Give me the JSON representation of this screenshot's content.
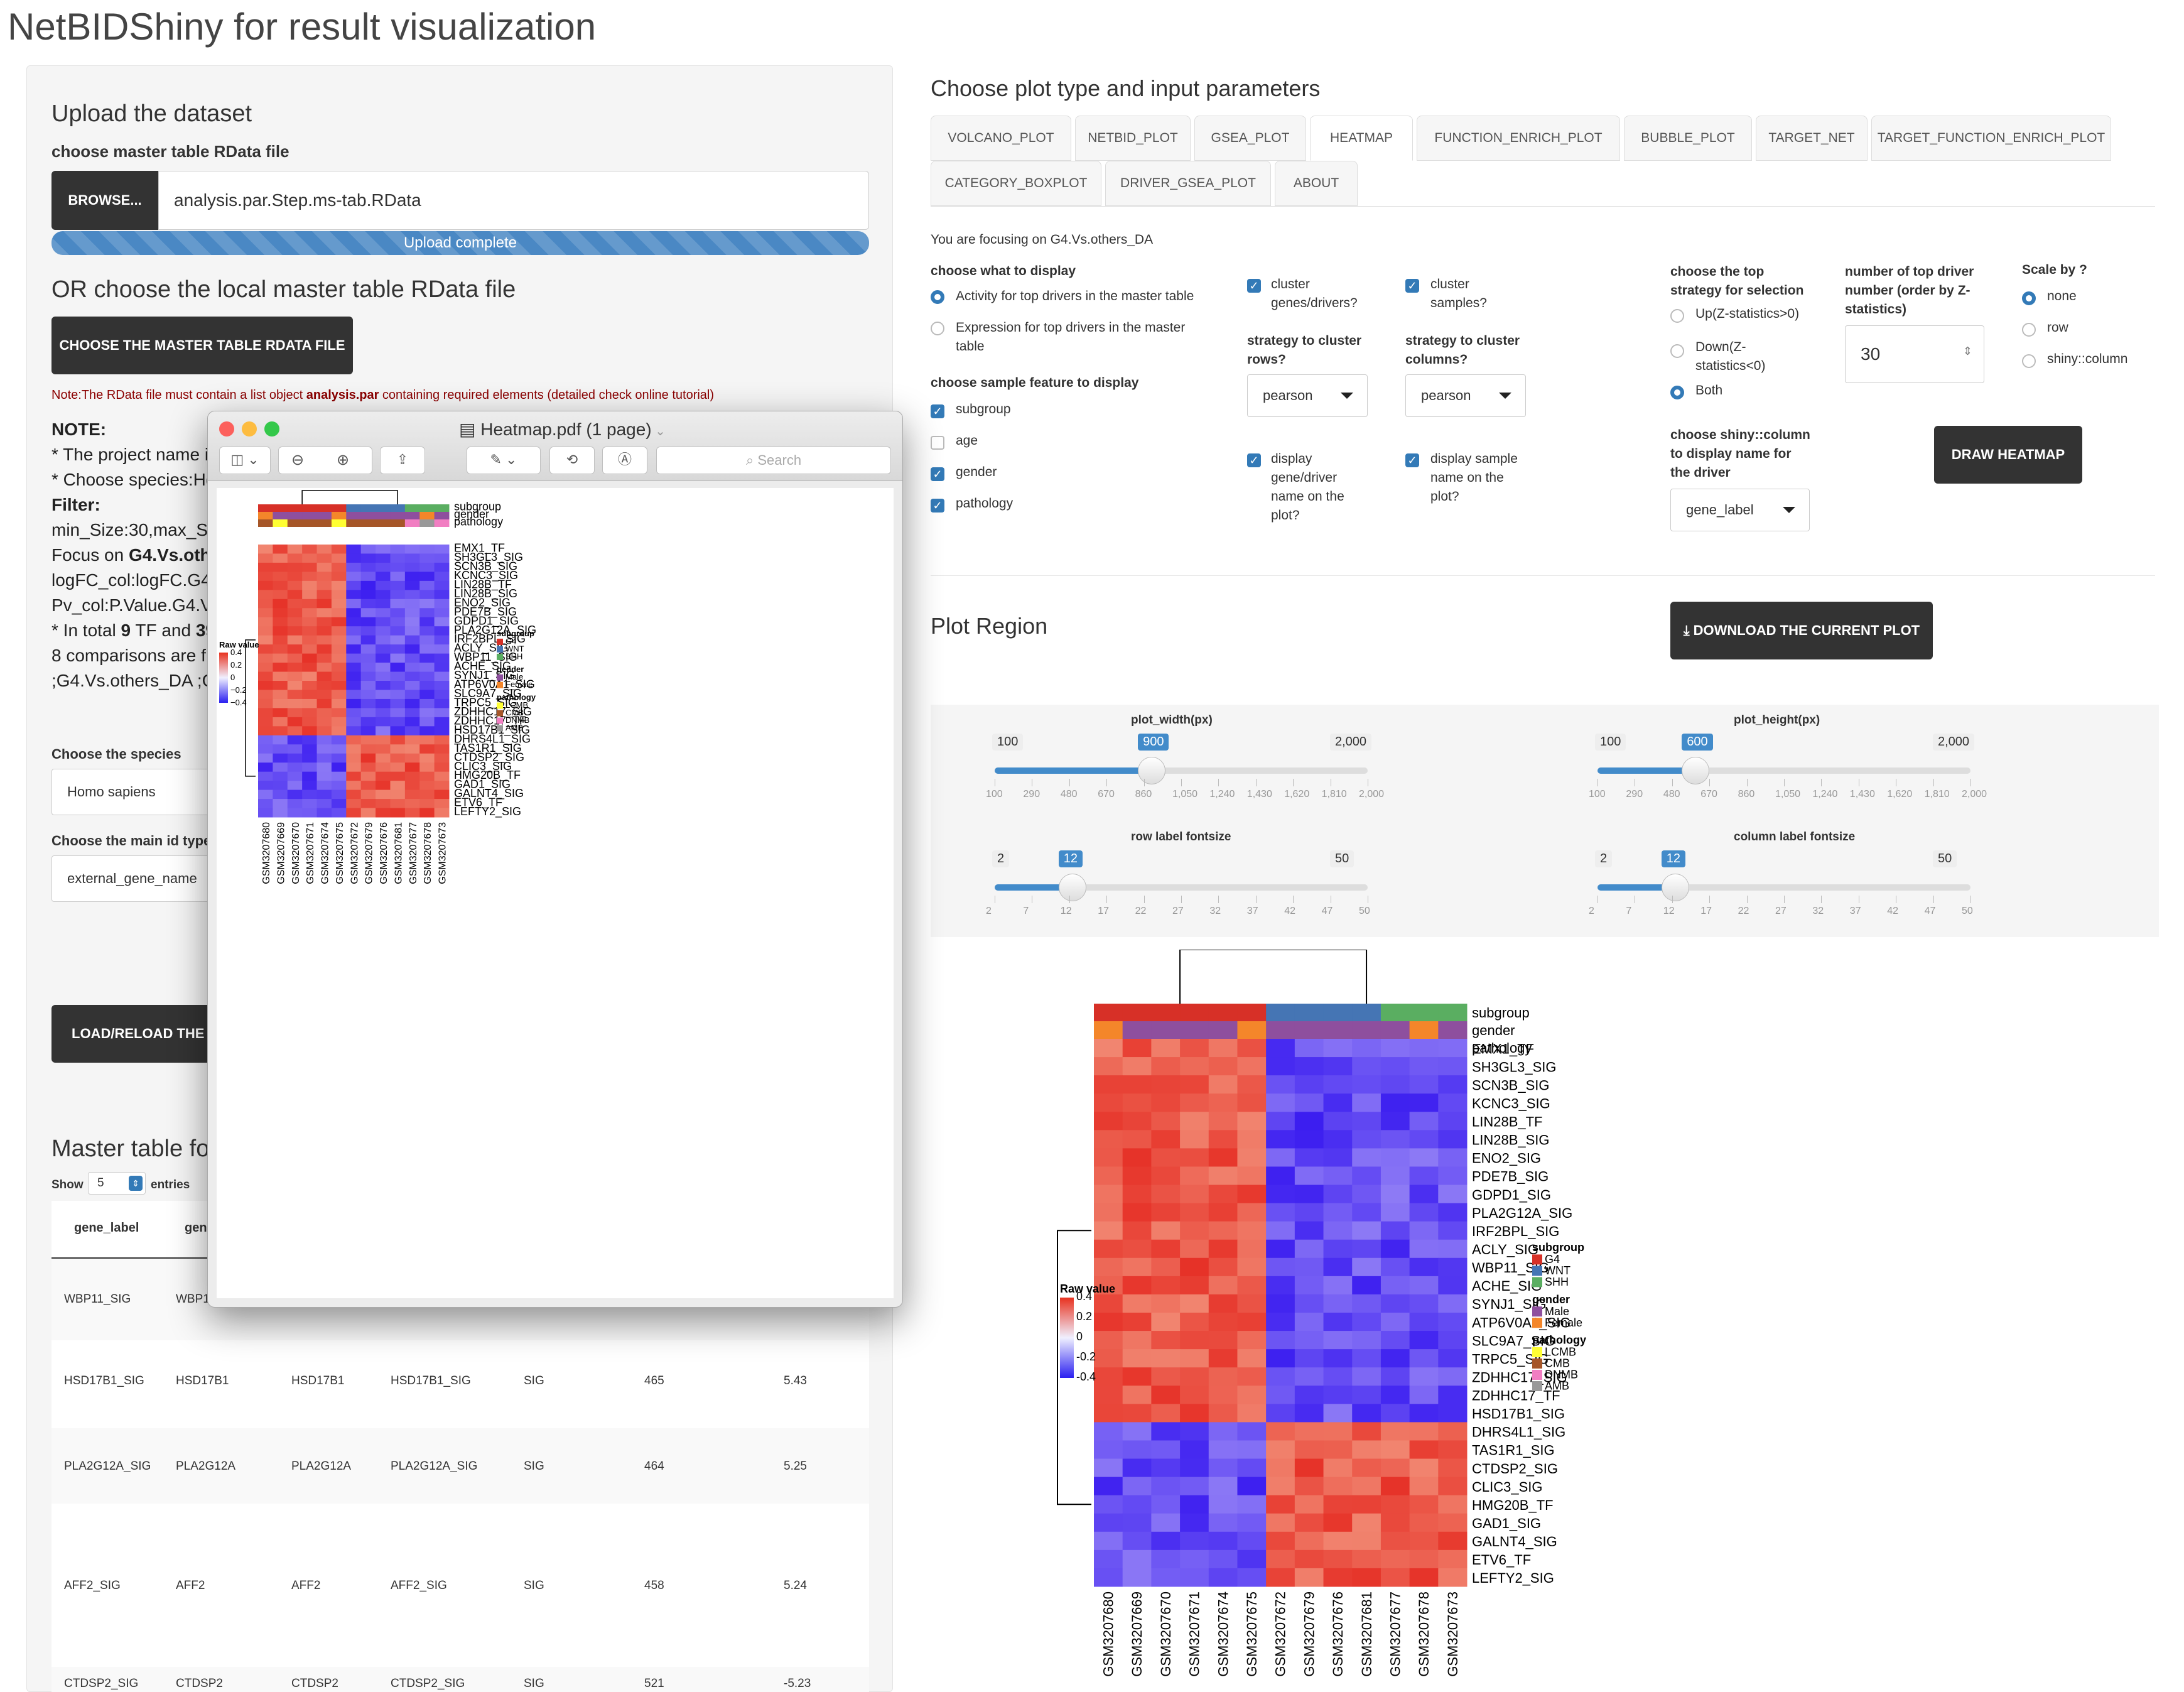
{
  "app_title": "NetBIDShiny for result visualization",
  "upload": {
    "heading": "Upload the dataset",
    "master_label": "choose master table RData file",
    "browse_label": "BROWSE...",
    "file_value": "analysis.par.Step.ms-tab.RData",
    "progress_text": "Upload complete",
    "progress_fraction": 1.0,
    "or_heading": "OR choose the local master table RData file",
    "choose_button": "CHOOSE THE MASTER TABLE RDATA FILE",
    "note_prefix": "Note:The RData file must contain a list object ",
    "note_bold": "analysis.par",
    "note_suffix": " containing required elements (detailed check online tutorial)"
  },
  "notes": {
    "l1": "NOTE:",
    "l2": "* The project name i",
    "l3": "* Choose species:Ho",
    "l4": "Filter:",
    "l5": "min_Size:30,max_Si",
    "l6a": "Focus on ",
    "l6b": "G4.Vs.othe",
    "l7": "logFC_col:logFC.G4.",
    "l8": "Pv_col:P.Value.G4.V",
    "l9a": "* In total ",
    "l9b": "9",
    "l9c": " TF and ",
    "l9d": "39",
    "l10": "8 comparisons are f",
    "l11": ";G4.Vs.others_DA ;G"
  },
  "species": {
    "label": "Choose the species",
    "value": "Homo sapiens"
  },
  "idtype": {
    "label": "Choose the main id type",
    "value": "external_gene_name"
  },
  "load_button": "LOAD/RELOAD THE UI",
  "master_table": {
    "heading": "Master table for",
    "show_label": "Show",
    "show_value": "5",
    "entries_label": "entries",
    "col1": "gene_label",
    "col2": "gene",
    "rows": [
      [
        "WBP11_SIG",
        "WBP1",
        "",
        "",
        "",
        "",
        ""
      ],
      [
        "HSD17B1_SIG",
        "HSD17B1",
        "HSD17B1",
        "HSD17B1_SIG",
        "SIG",
        "465",
        "5.43"
      ],
      [
        "PLA2G12A_SIG",
        "PLA2G12A",
        "PLA2G12A",
        "PLA2G12A_SIG",
        "SIG",
        "464",
        "5.25"
      ],
      [
        "AFF2_SIG",
        "AFF2",
        "AFF2",
        "AFF2_SIG",
        "SIG",
        "458",
        "5.24"
      ],
      [
        "CTDSP2_SIG",
        "CTDSP2",
        "CTDSP2",
        "CTDSP2_SIG",
        "SIG",
        "521",
        "-5.23"
      ]
    ]
  },
  "right": {
    "heading": "Choose plot type and input parameters",
    "tabs": [
      "VOLCANO_PLOT",
      "NETBID_PLOT",
      "GSEA_PLOT",
      "HEATMAP",
      "FUNCTION_ENRICH_PLOT",
      "BUBBLE_PLOT",
      "TARGET_NET",
      "TARGET_FUNCTION_ENRICH_PLOT",
      "CATEGORY_BOXPLOT",
      "DRIVER_GSEA_PLOT",
      "ABOUT"
    ],
    "focus_text": "You are focusing on G4.Vs.others_DA",
    "display_label": "choose what to display",
    "display_opt1": "Activity for top drivers in the master table",
    "display_opt2a": "Expression for top drivers in the master",
    "display_opt2b": "table",
    "sample_feature_label": "choose sample feature to display",
    "features": [
      "subgroup",
      "age",
      "gender",
      "pathology"
    ],
    "cluster_genes_a": "cluster",
    "cluster_genes_b": "genes/drivers?",
    "cluster_samples_a": "cluster",
    "cluster_samples_b": "samples?",
    "strategy_rows_a": "strategy to cluster",
    "strategy_rows_b": "rows?",
    "strategy_rows_value": "pearson",
    "strategy_cols_a": "strategy to cluster",
    "strategy_cols_b": "columns?",
    "strategy_cols_value": "pearson",
    "display_gene_a": "display",
    "display_gene_b": "gene/driver",
    "display_gene_c": "name on the",
    "display_gene_d": "plot?",
    "display_sample_a": "display sample",
    "display_sample_b": "name on the",
    "display_sample_c": "plot?",
    "top_strategy_a": "choose the top",
    "top_strategy_b": "strategy for selection",
    "strat_up": "Up(Z-statistics>0)",
    "strat_down_a": "Down(Z-",
    "strat_down_b": "statistics<0)",
    "strat_both": "Both",
    "topnum_a": "number of top driver",
    "topnum_b": "number (order by Z-",
    "topnum_c": "statistics)",
    "topnum_value": "30",
    "scale_label": "Scale by ?",
    "scale_none": "none",
    "scale_row": "row",
    "scale_col": "shiny::column",
    "shinycol_a": "choose shiny::column",
    "shinycol_b": "to display name for",
    "shinycol_c": "the driver",
    "shinycol_value": "gene_label",
    "draw_button": "DRAW HEATMAP",
    "plot_region": "Plot Region",
    "download_button": "DOWNLOAD THE CURRENT PLOT"
  },
  "sliders": {
    "width": {
      "title": "plot_width(px)",
      "min": "100",
      "max": "2,000",
      "value": "900",
      "ticks": [
        "100",
        "290",
        "480",
        "670",
        "860",
        "1,050",
        "1,240",
        "1,430",
        "1,620",
        "1,810",
        "2,000"
      ]
    },
    "height": {
      "title": "plot_height(px)",
      "min": "100",
      "max": "2,000",
      "value": "600",
      "ticks": [
        "100",
        "290",
        "480",
        "670",
        "860",
        "1,050",
        "1,240",
        "1,430",
        "1,620",
        "1,810",
        "2,000"
      ]
    },
    "row_font": {
      "title": "row label fontsize",
      "min": "2",
      "max": "50",
      "value": "12",
      "ticks": [
        "2",
        "7",
        "12",
        "17",
        "22",
        "27",
        "32",
        "37",
        "42",
        "47",
        "50"
      ]
    },
    "col_font": {
      "title": "column label fontsize",
      "min": "2",
      "max": "50",
      "value": "12",
      "ticks": [
        "2",
        "7",
        "12",
        "17",
        "22",
        "27",
        "32",
        "37",
        "42",
        "47",
        "50"
      ]
    }
  },
  "heatmap": {
    "annotation_names": [
      "subgroup",
      "gender",
      "pathology"
    ],
    "rows": [
      "EMX1_TF",
      "SH3GL3_SIG",
      "SCN3B_SIG",
      "KCNC3_SIG",
      "LIN28B_TF",
      "LIN28B_SIG",
      "ENO2_SIG",
      "PDE7B_SIG",
      "GDPD1_SIG",
      "PLA2G12A_SIG",
      "IRF2BPL_SIG",
      "ACLY_SIG",
      "WBP11_SIG",
      "ACHE_SIG",
      "SYNJ1_SIG",
      "ATP6V0A1_SIG",
      "SLC9A7_SIG",
      "TRPC5_SIG",
      "ZDHHC17_SIG",
      "ZDHHC17_TF",
      "HSD17B1_SIG",
      "DHRS4L1_SIG",
      "TAS1R1_SIG",
      "CTDSP2_SIG",
      "CLIC3_SIG",
      "HMG20B_TF",
      "GAD1_SIG",
      "GALNT4_SIG",
      "ETV6_TF",
      "LEFTY2_SIG"
    ],
    "columns": [
      "GSM3207680",
      "GSM3207669",
      "GSM3207670",
      "GSM3207671",
      "GSM3207674",
      "GSM3207675",
      "GSM3207672",
      "GSM3207679",
      "GSM3207676",
      "GSM3207681",
      "GSM3207677",
      "GSM3207678",
      "GSM3207673"
    ],
    "subgroup": [
      "G4",
      "G4",
      "G4",
      "G4",
      "G4",
      "G4",
      "WNT",
      "WNT",
      "WNT",
      "WNT",
      "SHH",
      "SHH",
      "SHH"
    ],
    "gender": [
      "Female",
      "Male",
      "Male",
      "Male",
      "Male",
      "Female",
      "Male",
      "Male",
      "Male",
      "Male",
      "Male",
      "Female",
      "Male"
    ],
    "pathology": [
      "CMB",
      "LCMB",
      "CMB",
      "CMB",
      "CMB",
      "LCMB",
      "CMB",
      "CMB",
      "CMB",
      "CMB",
      "DNMB",
      "AMB",
      "DNMB"
    ],
    "legend_title": "Raw value",
    "legend_ticks": [
      "0.4",
      "0.2",
      "0",
      "-0.2",
      "-0.4"
    ],
    "legend_ticks_pdf": [
      "0.4",
      "0.2",
      "0",
      "−0.2",
      "−0.4"
    ],
    "legend_groups": [
      {
        "title": "subgroup",
        "items": [
          {
            "label": "G4",
            "color": "#d73027"
          },
          {
            "label": "WNT",
            "color": "#4575b4"
          },
          {
            "label": "SHH",
            "color": "#5aae61"
          }
        ]
      },
      {
        "title": "gender",
        "items": [
          {
            "label": "Male",
            "color": "#8e4f9e"
          },
          {
            "label": "Female",
            "color": "#f4862a"
          }
        ]
      },
      {
        "title": "pathology",
        "items": [
          {
            "label": "LCMB",
            "color": "#ffff33"
          },
          {
            "label": "CMB",
            "color": "#a65628"
          },
          {
            "label": "DNMB",
            "color": "#f17ec2"
          },
          {
            "label": "AMB",
            "color": "#999999"
          }
        ]
      }
    ]
  },
  "pdf_viewer": {
    "title": "Heatmap.pdf (1 page)",
    "search_placeholder": "Search"
  },
  "colors": {
    "accent": "#337ab7",
    "dark_button": "#333333",
    "heat_high": "#e8321f",
    "heat_low": "#3a2ff0"
  }
}
